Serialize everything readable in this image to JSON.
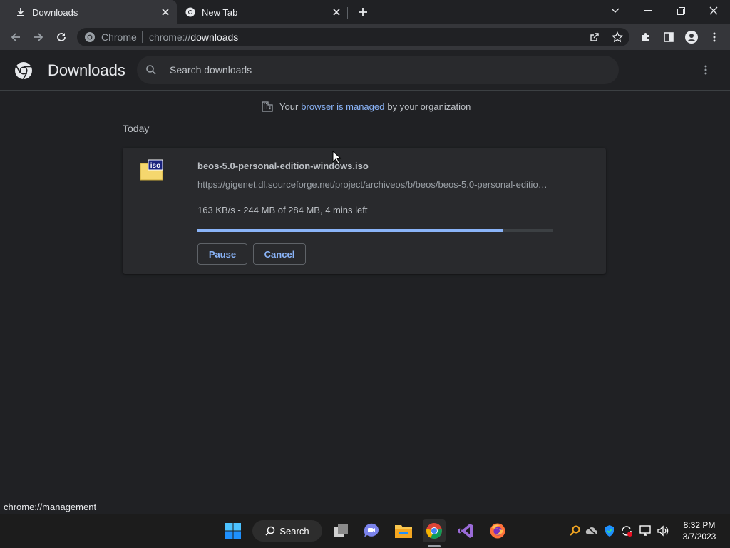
{
  "tabs": [
    {
      "title": "Downloads",
      "icon": "download-icon",
      "active": true
    },
    {
      "title": "New Tab",
      "icon": "chrome-icon",
      "active": false
    }
  ],
  "omnibox": {
    "site_label": "Chrome",
    "url_scheme": "chrome://",
    "url_host": "downloads"
  },
  "page": {
    "title": "Downloads",
    "search_placeholder": "Search downloads"
  },
  "managed_notice": {
    "prefix": "Your",
    "link": "browser is managed",
    "suffix": "by your organization"
  },
  "section_label": "Today",
  "download": {
    "file_name": "beos-5.0-personal-edition-windows.iso",
    "url": "https://gigenet.dl.sourceforge.net/project/archiveos/b/beos/beos-5.0-personal-edition-windows.iso",
    "status": "163 KB/s - 244 MB of 284 MB, 4 mins left",
    "progress_fraction": 0.859,
    "pause_label": "Pause",
    "cancel_label": "Cancel"
  },
  "status_bubble": "chrome://management",
  "taskbar": {
    "search_label": "Search",
    "time": "8:32 PM",
    "date": "3/7/2023"
  },
  "colors": {
    "accent": "#8ab4f8",
    "background": "#202124",
    "surface": "#292a2d",
    "toolbar": "#35363a"
  }
}
